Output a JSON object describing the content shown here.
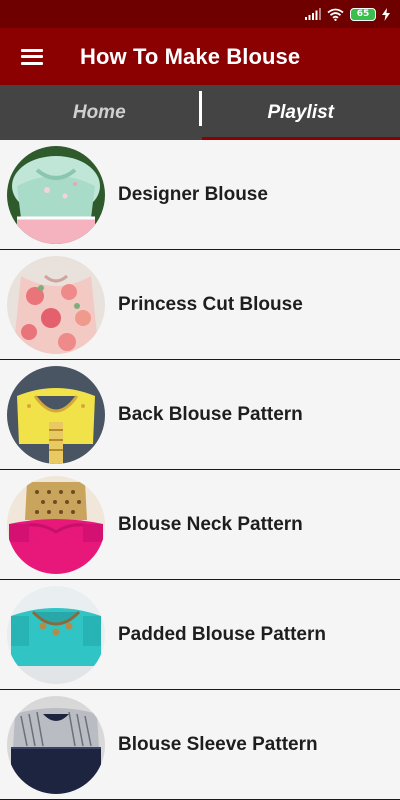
{
  "status_bar": {
    "battery_level": "65"
  },
  "app_bar": {
    "title": "How To Make Blouse"
  },
  "tabs": [
    {
      "label": "Home",
      "active": false
    },
    {
      "label": "Playlist",
      "active": true
    }
  ],
  "list": {
    "items": [
      {
        "label": "Designer Blouse",
        "thumbnail": "mint-blouse-peach-fringe"
      },
      {
        "label": "Princess Cut Blouse",
        "thumbnail": "pink-floral-blouse"
      },
      {
        "label": "Back Blouse Pattern",
        "thumbnail": "yellow-back-blouse"
      },
      {
        "label": "Blouse Neck Pattern",
        "thumbnail": "pink-gold-neck-blouse"
      },
      {
        "label": "Padded Blouse Pattern",
        "thumbnail": "turquoise-padded-blouse"
      },
      {
        "label": "Blouse Sleeve Pattern",
        "thumbnail": "navy-sequin-sleeve-blouse"
      }
    ]
  },
  "colors": {
    "primary": "#8b0000",
    "status_bar": "#6f0000",
    "tab_bar": "#444444",
    "background": "#f5f5f5"
  }
}
